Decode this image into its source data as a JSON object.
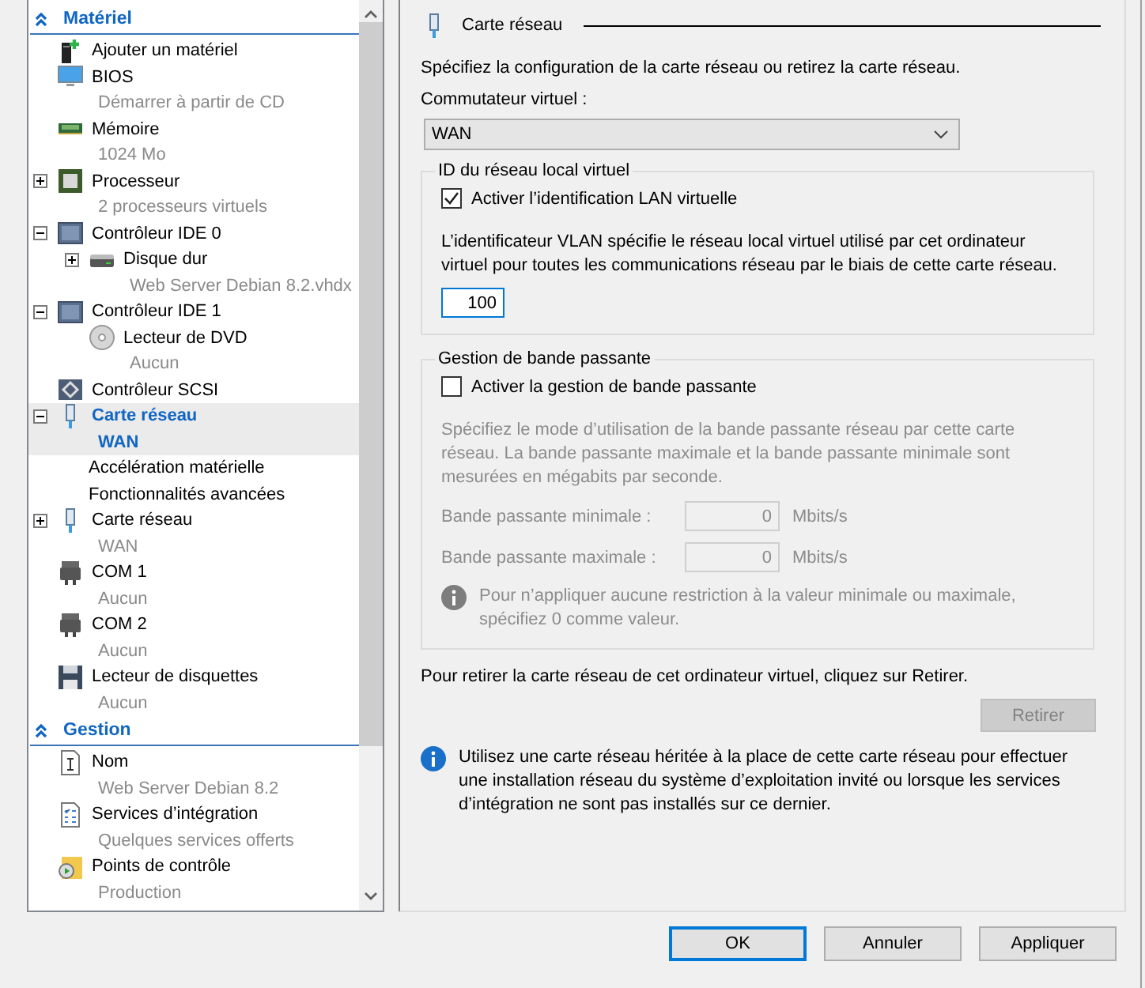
{
  "tree": {
    "sections": [
      {
        "title": "Matériel",
        "expanded": true,
        "items": [
          {
            "label": "Ajouter un matériel",
            "kind": "add",
            "selected": false
          },
          {
            "label": "BIOS",
            "detail": "Démarrer à partir de CD",
            "kind": "bios",
            "selected": false
          },
          {
            "label": "Mémoire",
            "detail": "1024 Mo",
            "kind": "memory",
            "selected": false
          },
          {
            "label": "Processeur",
            "detail": "2 processeurs virtuels",
            "kind": "processor",
            "expanded": false,
            "selected": false
          },
          {
            "label": "Contrôleur IDE 0",
            "kind": "controller",
            "expanded": true,
            "selected": false,
            "children": [
              {
                "label": "Disque dur",
                "detail": "Web Server Debian 8.2.vhdx",
                "kind": "disk",
                "expanded": false,
                "selected": false
              }
            ]
          },
          {
            "label": "Contrôleur IDE 1",
            "kind": "controller",
            "expanded": true,
            "selected": false,
            "children": [
              {
                "label": "Lecteur de DVD",
                "detail": "Aucun",
                "kind": "dvd",
                "selected": false
              }
            ]
          },
          {
            "label": "Contrôleur SCSI",
            "kind": "scsi",
            "selected": false
          },
          {
            "label": "Carte réseau",
            "detail": "WAN",
            "kind": "network",
            "expanded": true,
            "selected": true,
            "children": [
              {
                "label": "Accélération matérielle",
                "selected": false
              },
              {
                "label": "Fonctionnalités avancées",
                "selected": false
              }
            ]
          },
          {
            "label": "Carte réseau",
            "detail": "WAN",
            "kind": "network",
            "expanded": false,
            "selected": false
          },
          {
            "label": "COM 1",
            "detail": "Aucun",
            "kind": "port",
            "selected": false
          },
          {
            "label": "COM 2",
            "detail": "Aucun",
            "kind": "port",
            "selected": false
          },
          {
            "label": "Lecteur de disquettes",
            "detail": "Aucun",
            "kind": "floppy",
            "selected": false
          }
        ]
      },
      {
        "title": "Gestion",
        "expanded": true,
        "items": [
          {
            "label": "Nom",
            "detail": "Web Server Debian 8.2",
            "kind": "name",
            "selected": false
          },
          {
            "label": "Services d’intégration",
            "detail": "Quelques services offerts",
            "kind": "services",
            "selected": false
          },
          {
            "label": "Points de contrôle",
            "detail": "Production",
            "kind": "checkpoint",
            "selected": false
          }
        ]
      }
    ]
  },
  "panel": {
    "title": "Carte réseau",
    "intro": "Spécifiez la configuration de la carte réseau ou retirez la carte réseau.",
    "switch": {
      "label": "Commutateur virtuel :",
      "value": "WAN"
    },
    "vlan": {
      "legend": "ID du réseau local virtuel",
      "checkbox": {
        "label": "Activer l’identification LAN virtuelle",
        "checked": true
      },
      "description": "L’identificateur VLAN spécifie le réseau local virtuel utilisé par cet ordinateur virtuel pour toutes les communications réseau par le biais de cette carte réseau.",
      "value": "100",
      "focused": true
    },
    "bandwidth": {
      "legend": "Gestion de bande passante",
      "checkbox": {
        "label": "Activer la gestion de bande passante",
        "checked": false
      },
      "disabled": true,
      "description": "Spécifiez le mode d’utilisation de la bande passante réseau par cette carte réseau. La bande passante maximale et la bande passante minimale sont mesurées en mégabits par seconde.",
      "fields": [
        {
          "label": "Bande passante minimale :",
          "value": "0",
          "unit": "Mbits/s"
        },
        {
          "label": "Bande passante maximale :",
          "value": "0",
          "unit": "Mbits/s"
        }
      ],
      "note": "Pour n’appliquer aucune restriction à la valeur minimale ou maximale, spécifiez 0 comme valeur."
    },
    "remove": {
      "text": "Pour retirer la carte réseau de cet ordinateur virtuel, cliquez sur Retirer.",
      "button": {
        "label": "Retirer",
        "disabled": true
      }
    },
    "info": "Utilisez une carte réseau héritée à la place de cette carte réseau pour effectuer une installation réseau du système d’exploitation invité ou lorsque les services d’intégration ne sont pas installés sur ce dernier."
  },
  "buttons": [
    {
      "label": "OK",
      "default": true
    },
    {
      "label": "Annuler",
      "default": false
    },
    {
      "label": "Appliquer",
      "default": false
    }
  ]
}
